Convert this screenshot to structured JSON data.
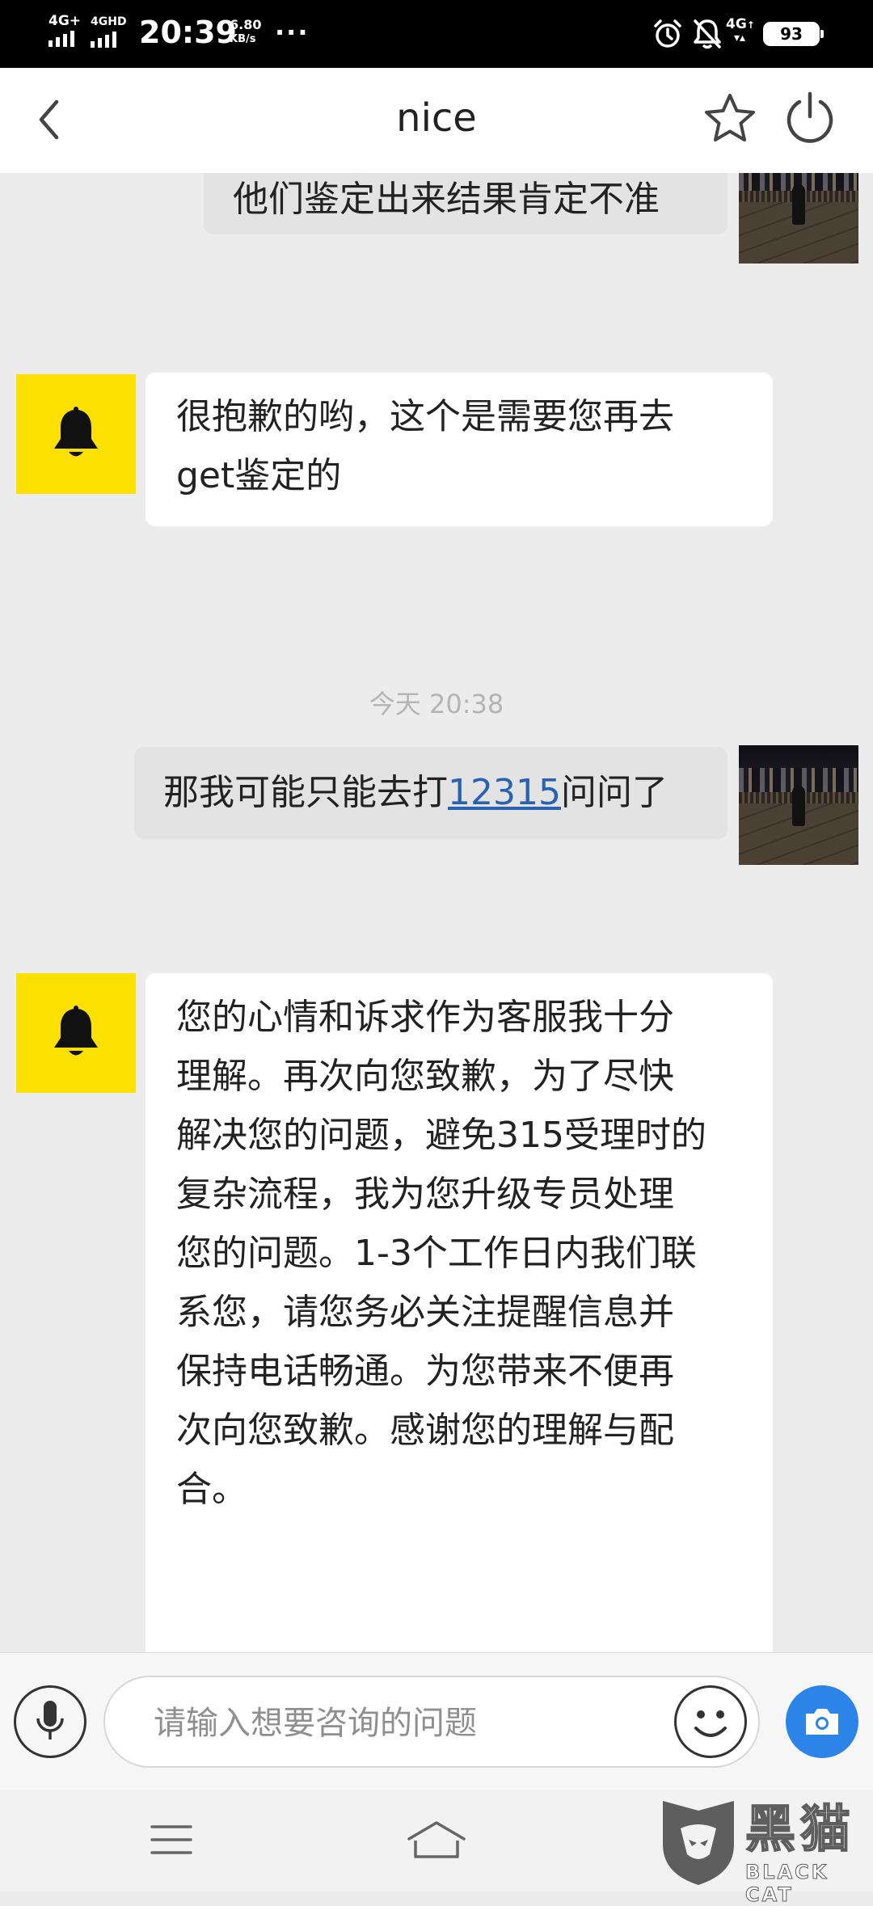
{
  "status_bar": {
    "signal1": "4G+",
    "signal2": "4GHD",
    "time": "20:39",
    "speed_value": "6.80",
    "speed_unit": "KB/s",
    "more": "···",
    "signal3": "4G",
    "battery": "93"
  },
  "header": {
    "title": "nice",
    "icons": [
      "back-icon",
      "star-icon",
      "power-icon"
    ]
  },
  "messages": [
    {
      "from": "user",
      "text": "他们鉴定出来结果肯定不准"
    },
    {
      "from": "bot",
      "line1": "很抱歉的哟，这个是需要您再去",
      "line2": "get鉴定的"
    },
    {
      "timestamp": "今天 20:38"
    },
    {
      "from": "user",
      "before": "那我可能只能去打",
      "link": "12315",
      "after": "问问了"
    },
    {
      "from": "bot",
      "lines": [
        "您的心情和诉求作为客服我十分",
        "理解。再次向您致歉，为了尽快",
        "解决您的问题，避免315受理时的",
        "复杂流程，我为您升级专员处理",
        "您的问题。1-3个工作日内我们联",
        "系您，请您务必关注提醒信息并",
        "保持电话畅通。为您带来不便再",
        "次向您致歉。感谢您的理解与配",
        "合。"
      ]
    }
  ],
  "input_bar": {
    "placeholder": "请输入想要咨询的问题",
    "icons": [
      "mic-icon",
      "emoji-icon",
      "camera-icon"
    ]
  },
  "nav_bar": {
    "icons": [
      "menu-icon",
      "home-icon"
    ]
  },
  "watermark": {
    "cn": "黑猫",
    "en": "BLACK CAT"
  },
  "colors": {
    "bot_avatar": "#fbe000",
    "link": "#2a62b2",
    "camera": "#2d84e8",
    "chat_bg": "#ececec"
  }
}
